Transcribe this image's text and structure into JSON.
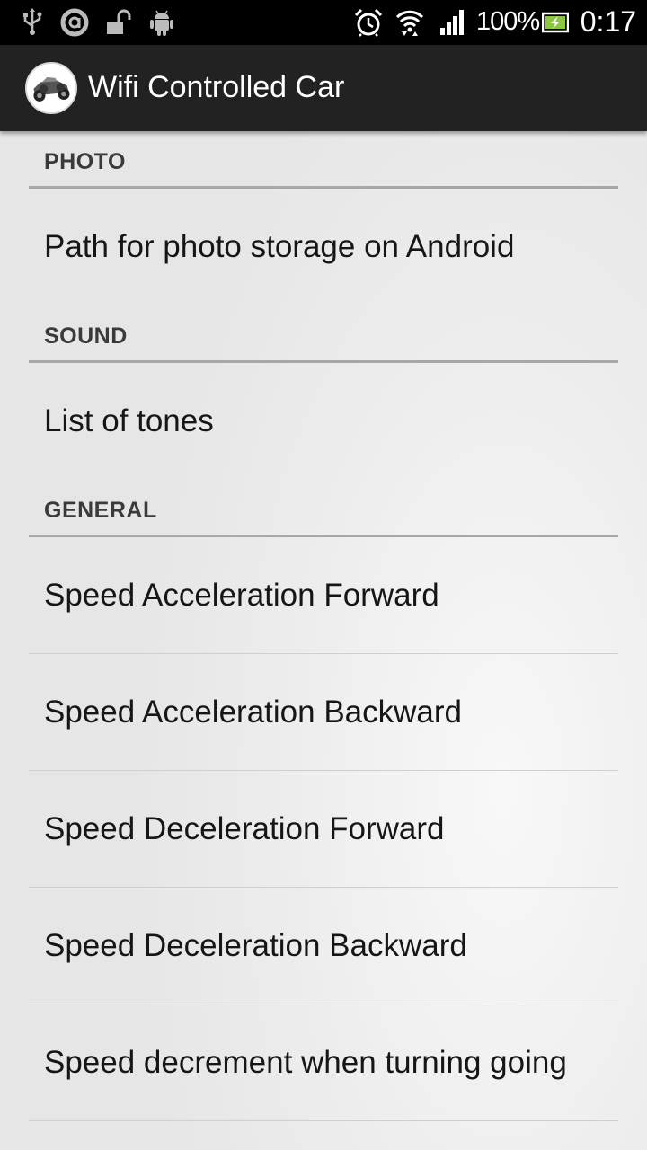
{
  "status_bar": {
    "battery_percent": "100%",
    "time": "0:17",
    "left_icons": [
      "usb-icon",
      "a-circle-icon",
      "unlock-icon",
      "android-debug-icon"
    ],
    "right_icons": [
      "alarm-icon",
      "wifi-icon",
      "signal-icon",
      "battery-charging-icon"
    ]
  },
  "action_bar": {
    "title": "Wifi Controlled Car",
    "app_icon": "rc-car-icon"
  },
  "preferences": {
    "photo": {
      "header": "PHOTO",
      "items": [
        "Path for photo storage on Android"
      ]
    },
    "sound": {
      "header": "SOUND",
      "items": [
        "List of tones"
      ]
    },
    "general": {
      "header": "GENERAL",
      "items": [
        "Speed Acceleration Forward",
        "Speed Acceleration Backward",
        "Speed Deceleration Forward",
        "Speed Deceleration Backward",
        "Speed decrement when turning going"
      ]
    }
  },
  "colors": {
    "status_bar_bg": "#000000",
    "action_bar_bg": "#222222",
    "category_text": "#3a3a3a",
    "item_text": "#161616",
    "category_line": "#a7a7a7"
  }
}
